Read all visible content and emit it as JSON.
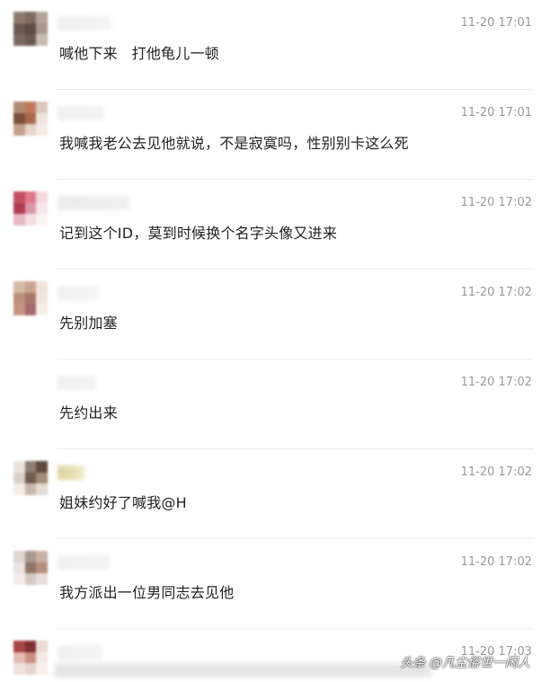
{
  "comments": [
    {
      "text": "喊他下来   打他龟儿一顿",
      "time": "11-20 17:01",
      "avatar_colors": [
        "#8e7b6f",
        "#7d6c63",
        "#b4a59b",
        "#695a51",
        "#5c4c44",
        "#a89990",
        "#7a6a61",
        "#6b5a50",
        "#c6bab2"
      ],
      "name_colors": [
        "#eeeeee",
        "#f4f4f4"
      ]
    },
    {
      "text": "我喊我老公去见他就说，不是寂寞吗，性别别卡这么死",
      "time": "11-20 17:01",
      "avatar_colors": [
        "#b08a73",
        "#c07a5a",
        "#d9c8bd",
        "#7a4f3a",
        "#a86a4c",
        "#efe5de",
        "#c4a08b",
        "#e6d5ca",
        "#f3ece6"
      ],
      "name_colors": [
        "#eeeeee",
        "#f2f2f2"
      ]
    },
    {
      "text": "记到这个ID，莫到时候换个名字头像又进来",
      "time": "11-20 17:02",
      "avatar_colors": [
        "#c44f63",
        "#e07a8b",
        "#f3d9de",
        "#b23a52",
        "#d99aa6",
        "#f7e8eb",
        "#e7b8c1",
        "#f5dce1",
        "#fbf2f4"
      ],
      "name_colors": [
        "#e9e9e9",
        "#f0f0f0"
      ]
    },
    {
      "text": "先别加塞",
      "time": "11-20 17:02",
      "avatar_colors": [
        "#d6b8a6",
        "#c9a491",
        "#efe3db",
        "#b88f7a",
        "#a7786a",
        "#f1e6df",
        "#c79482",
        "#a56a6a",
        "#f5eee9"
      ],
      "name_colors": [
        "#efefef",
        "#f4f4f4"
      ]
    },
    {
      "text": "先约出来",
      "time": "11-20 17:02",
      "avatar_colors": [
        "#ffffff",
        "#ffffff",
        "#ffffff",
        "#ffffff",
        "#ffffff",
        "#ffffff",
        "#ffffff",
        "#ffffff",
        "#ffffff"
      ],
      "name_colors": [
        "#eeeeee",
        "#f3f3f3"
      ]
    },
    {
      "text": "姐妹约好了喊我@H",
      "time": "11-20 17:02",
      "avatar_colors": [
        "#e9e4df",
        "#8f7f73",
        "#5e4b3f",
        "#d8d0c9",
        "#6f5b4d",
        "#a48c7a",
        "#f2eeea",
        "#c8b8ab",
        "#e3dbd4"
      ],
      "name_colors": [
        "#d8cc8f",
        "#efe8c6"
      ]
    },
    {
      "text": "我方派出一位男同志去见他",
      "time": "11-20 17:02",
      "avatar_colors": [
        "#ddd6d2",
        "#a89890",
        "#c8b0a2",
        "#eae4e0",
        "#8f7668",
        "#b48f7c",
        "#f1ece9",
        "#d5c9c2",
        "#e8dfda"
      ],
      "name_colors": [
        "#eeeeee",
        "#f3f3f3"
      ]
    },
    {
      "text": "",
      "time": "11-20 17:03",
      "avatar_colors": [
        "#a84545",
        "#7c2f2f",
        "#ebd9d5",
        "#e3b9b0",
        "#c98f84",
        "#f2e7e4",
        "#f0e2de",
        "#e8d4cf",
        "#f7efed"
      ],
      "name_colors": [
        "#eeeeee",
        "#f3f3f3"
      ]
    }
  ],
  "watermark": "头条 @凡尘俗世一闲人"
}
